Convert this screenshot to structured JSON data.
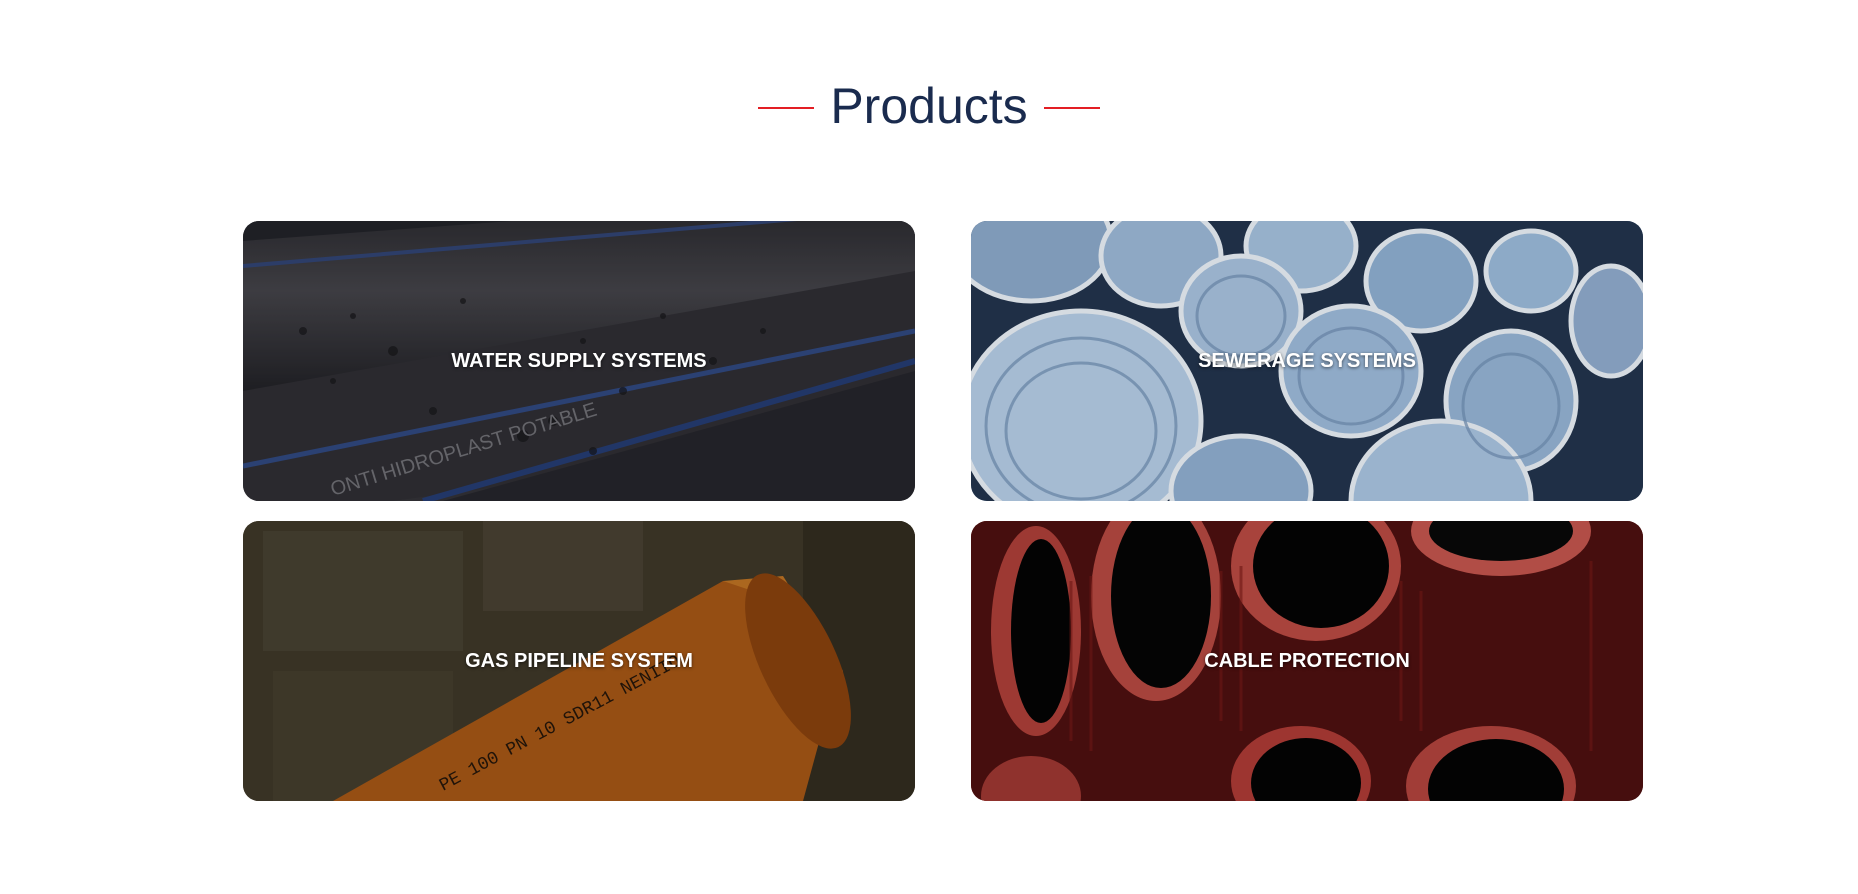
{
  "section": {
    "title": "Products"
  },
  "colors": {
    "title": "#1a2b4e",
    "accent_line": "#e31e24",
    "card_label": "#ffffff"
  },
  "products": [
    {
      "label": "WATER SUPPLY SYSTEMS",
      "image": "black-pe-pipes-water-droplets"
    },
    {
      "label": "SEWERAGE SYSTEMS",
      "image": "corrugated-blue-grey-pipes"
    },
    {
      "label": "GAS PIPELINE SYSTEM",
      "image": "orange-gas-pipe"
    },
    {
      "label": "CABLE PROTECTION",
      "image": "red-corrugated-cable-pipes"
    }
  ]
}
